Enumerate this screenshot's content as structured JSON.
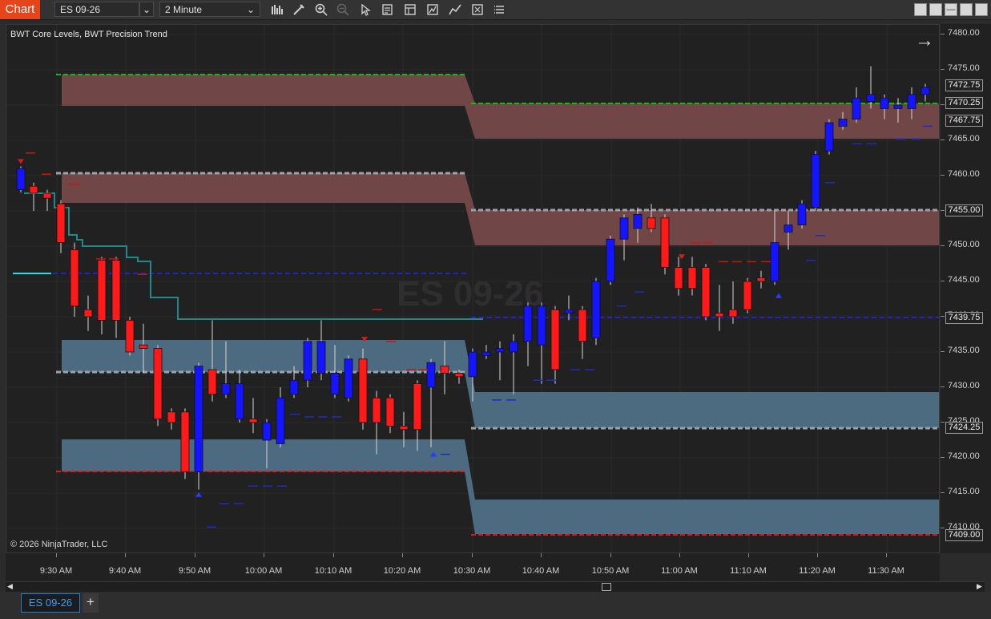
{
  "toolbar": {
    "app_badge": "Chart",
    "instrument": "ES 09-26",
    "interval": "2 Minute",
    "icons": [
      "bar-type-icon",
      "draw-tool-icon",
      "zoom-in-icon",
      "zoom-out-icon",
      "pointer-icon",
      "data-box-icon",
      "templates-icon",
      "strategies-icon",
      "indicators-icon",
      "properties-icon",
      "chart-trader-icon"
    ]
  },
  "chart": {
    "indicators_label": "BWT Core Levels, BWT Precision Trend",
    "watermark": "ES 09-26",
    "copyright": "© 2026 NinjaTrader, LLC"
  },
  "price_axis": {
    "ticks": [
      "7480.00",
      "7475.00",
      "7470.00",
      "7465.00",
      "7460.00",
      "7455.00",
      "7450.00",
      "7445.00",
      "7440.00",
      "7435.00",
      "7430.00",
      "7425.00",
      "7420.00",
      "7415.00",
      "7410.00"
    ],
    "labels": [
      "7472.75",
      "7470.25",
      "7467.75",
      "7455.00",
      "7439.75",
      "7424.25",
      "7409.00"
    ]
  },
  "time_axis": {
    "ticks": [
      "9:30 AM",
      "9:40 AM",
      "9:50 AM",
      "10:00 AM",
      "10:10 AM",
      "10:20 AM",
      "10:30 AM",
      "10:40 AM",
      "10:50 AM",
      "11:00 AM",
      "11:10 AM",
      "11:20 AM",
      "11:30 AM"
    ]
  },
  "tabs": [
    {
      "label": "ES 09-26"
    }
  ],
  "add_tab_label": "+",
  "colors": {
    "up": "#1414ff",
    "down": "#ff1a1a",
    "resistance_zone": "#7a4a4a",
    "support_zone": "#4f6f86",
    "trend_line": "#1f8a8a"
  }
}
